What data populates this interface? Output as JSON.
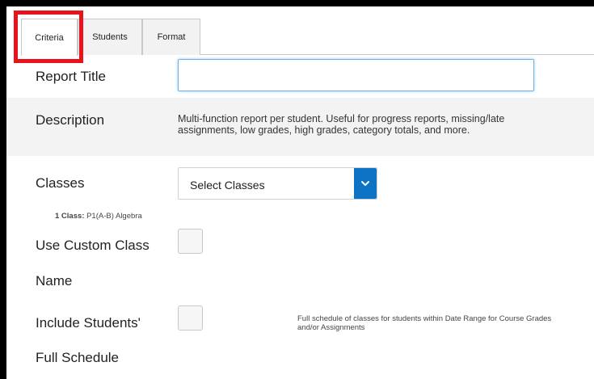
{
  "tabs": [
    {
      "label": "Criteria",
      "active": true
    },
    {
      "label": "Students",
      "active": false
    },
    {
      "label": "Format",
      "active": false
    }
  ],
  "report_title": {
    "label": "Report Title",
    "value": ""
  },
  "description": {
    "label": "Description",
    "text": "Multi-function report per student. Useful for progress reports, missing/late assignments, low grades, high grades, category totals, and more."
  },
  "classes": {
    "label": "Classes",
    "select_value": "Select Classes",
    "caption_count": "1 Class:",
    "caption_value": "P1(A-B) Algebra"
  },
  "custom_class_name": {
    "label_line1": "Use Custom Class",
    "label_line2": "Name",
    "checked": false
  },
  "full_schedule": {
    "label_line1": "Include Students'",
    "label_line2": "Full Schedule",
    "checked": false,
    "note": "Full schedule of classes for students within Date Range for Course Grades and/or Assignments"
  },
  "colors": {
    "accent": "#0d73c4",
    "highlight": "#e8131b"
  },
  "icons": {
    "select_arrow": "chevron-down-icon"
  }
}
